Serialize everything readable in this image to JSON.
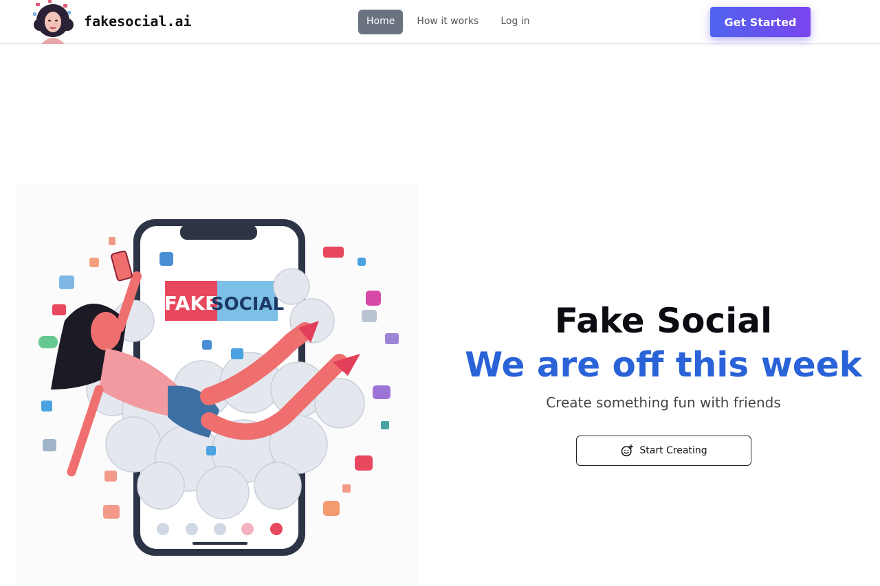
{
  "header": {
    "brand": "fakesocial.ai",
    "logo_icon": "woman-avatar-logo-icon",
    "nav": [
      {
        "label": "Home",
        "active": true
      },
      {
        "label": "How it works",
        "active": false
      },
      {
        "label": "Log in",
        "active": false
      }
    ],
    "cta_label": "Get Started"
  },
  "hero": {
    "illustration": {
      "phone_logo_left": "FAKE",
      "phone_logo_right": "SOCIAL"
    },
    "title": "Fake Social",
    "subtitle": "We are off this week",
    "tagline": "Create something fun with friends",
    "button_label": "Start Creating",
    "button_icon": "smile-plus-icon"
  },
  "colors": {
    "accent_blue": "#2a63d8",
    "cta_gradient_start": "#4f63f0",
    "cta_gradient_end": "#7a45ee",
    "nav_active_bg": "#6b7280"
  }
}
